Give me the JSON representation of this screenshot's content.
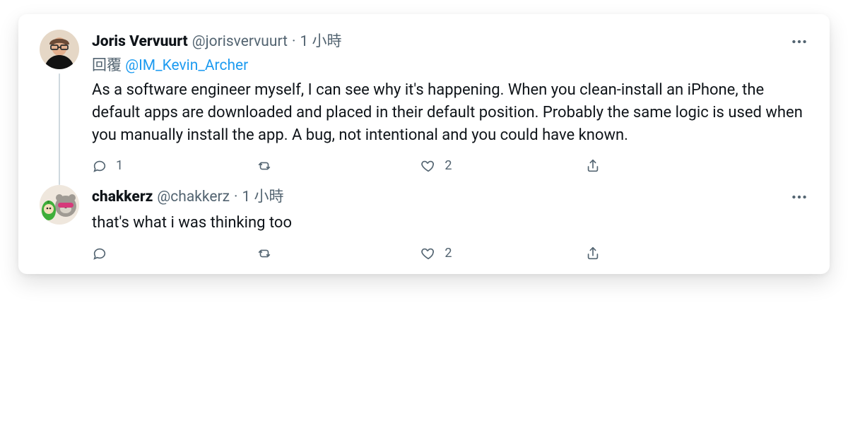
{
  "tweets": [
    {
      "display_name": "Joris Vervuurt",
      "handle": "@jorisvervuurt",
      "dot": "·",
      "timestamp": "1 小時",
      "reply_prefix": "回覆",
      "reply_mention": "@IM_Kevin_Archer",
      "body": "As a software engineer myself, I can see why it's happening. When you clean-install an iPhone, the default apps are downloaded and placed in their default position. Probably the same logic is used when you manually install the app. A bug, not intentional and you could have known.",
      "counts": {
        "reply": "1",
        "retweet": "",
        "like": "2",
        "share": ""
      }
    },
    {
      "display_name": "chakkerz",
      "handle": "@chakkerz",
      "dot": "·",
      "timestamp": "1 小時",
      "reply_prefix": "",
      "reply_mention": "",
      "body": "that's what i was thinking too",
      "counts": {
        "reply": "",
        "retweet": "",
        "like": "2",
        "share": ""
      }
    }
  ]
}
